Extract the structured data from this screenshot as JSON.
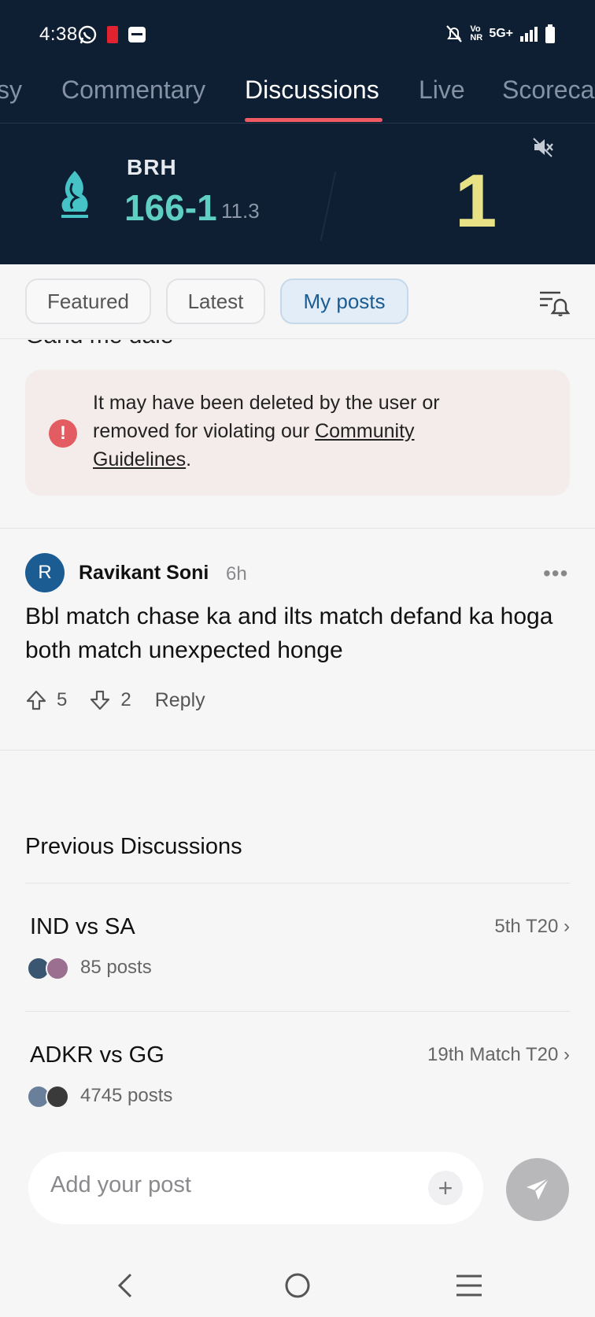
{
  "status_bar": {
    "time": "4:38",
    "network": "5G+",
    "volte": "Vo NR"
  },
  "tabs": [
    {
      "label": "sy",
      "active": false
    },
    {
      "label": "Commentary",
      "active": false
    },
    {
      "label": "Discussions",
      "active": true
    },
    {
      "label": "Live",
      "active": false
    },
    {
      "label": "Scoreca",
      "active": false
    }
  ],
  "score": {
    "team": "BRH",
    "runs_wickets": "166-1",
    "overs": "11.3",
    "last_ball": "1",
    "team_color": "#5ecfc2",
    "ball_color": "#e8e186"
  },
  "filters": [
    {
      "label": "Featured",
      "active": false
    },
    {
      "label": "Latest",
      "active": false
    },
    {
      "label": "My posts",
      "active": true
    }
  ],
  "cut_post_text": "Gand me dale",
  "deleted_notice": {
    "text_before": "It may have been deleted by the user or removed for violating our ",
    "link": "Community Guidelines",
    "text_after": "."
  },
  "post": {
    "avatar_letter": "R",
    "author": "Ravikant Soni",
    "time": "6h",
    "body": "Bbl match chase ka and ilts match defand ka hoga both match unexpected honge",
    "upvotes": "5",
    "downvotes": "2",
    "reply_label": "Reply"
  },
  "previous_discussions": {
    "title": "Previous Discussions",
    "matches": [
      {
        "name": "IND vs SA",
        "info": "5th T20 ›",
        "posts": "85 posts"
      },
      {
        "name": "ADKR vs GG",
        "info": "19th Match T20 ›",
        "posts": "4745 posts"
      }
    ]
  },
  "composer": {
    "placeholder": "Add your post",
    "plus": "+"
  },
  "colors": {
    "header_bg": "#0e1e33",
    "accent_red": "#ef5a63",
    "chip_active": "#1b5c93"
  }
}
